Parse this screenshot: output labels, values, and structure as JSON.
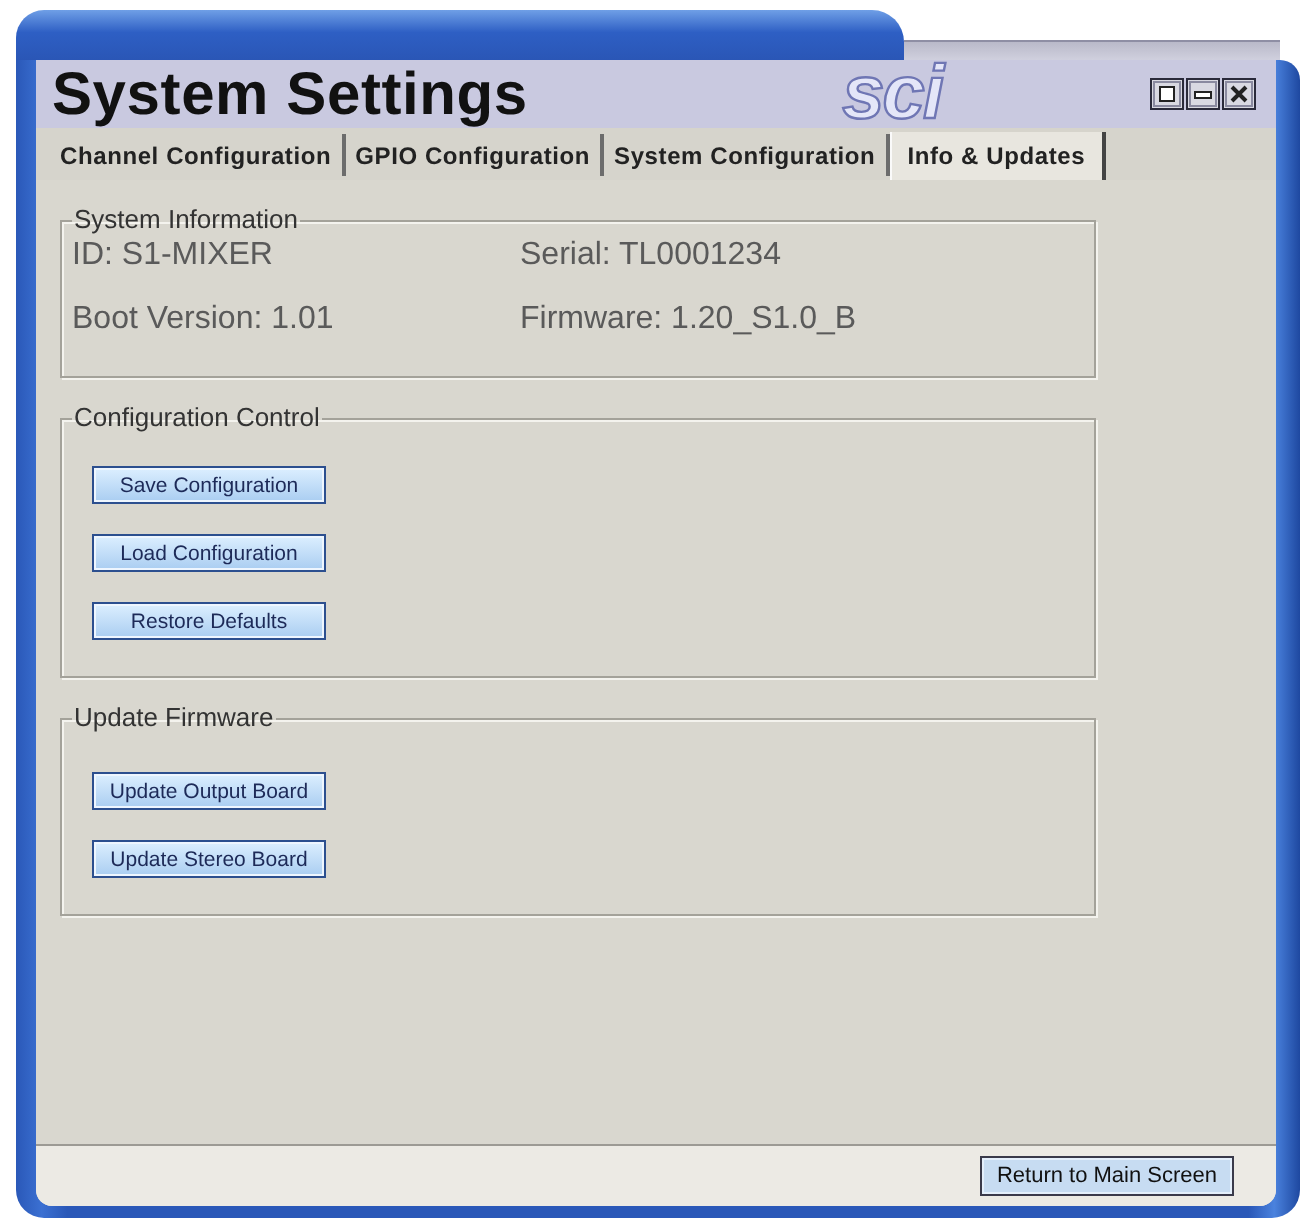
{
  "window": {
    "title": "System Settings",
    "logo": "sci"
  },
  "tabs": [
    {
      "label": "Channel Configuration",
      "selected": false
    },
    {
      "label": "GPIO Configuration",
      "selected": false
    },
    {
      "label": "System Configuration",
      "selected": false
    },
    {
      "label": "Info & Updates",
      "selected": true
    }
  ],
  "groups": [
    {
      "kind": "info",
      "title": "System Information",
      "items": [
        "ID: S1-MIXER",
        "Serial: TL0001234",
        "Boot Version: 1.01",
        "Firmware: 1.20_S1.0_B"
      ]
    },
    {
      "kind": "buttons",
      "title": "Configuration Control",
      "buttons": [
        "Save Configuration",
        "Load Configuration",
        "Restore Defaults"
      ]
    },
    {
      "kind": "buttons",
      "title": "Update Firmware",
      "buttons": [
        "Update Output Board",
        "Update Stereo Board"
      ]
    }
  ],
  "footer": {
    "button": "Return to Main Screen"
  }
}
